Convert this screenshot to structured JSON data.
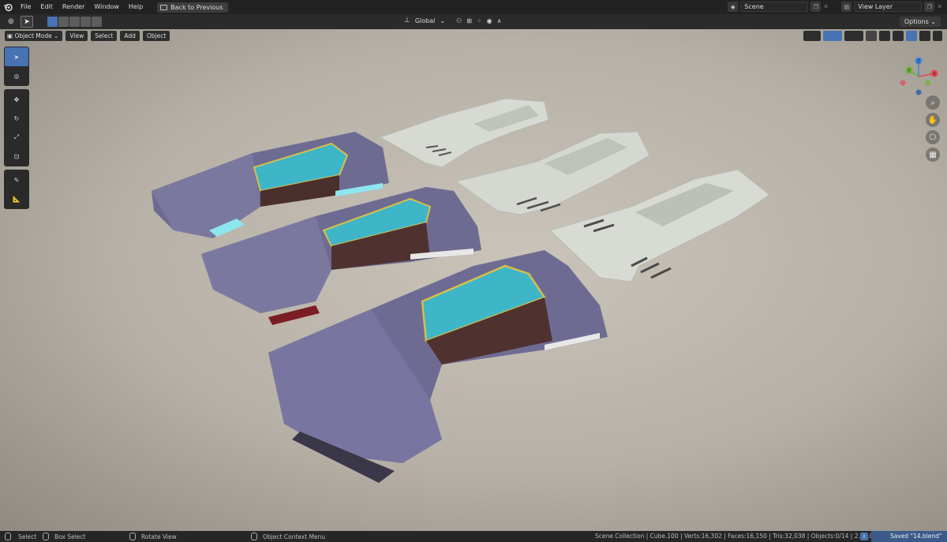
{
  "menubar": {
    "items": [
      "File",
      "Edit",
      "Render",
      "Window",
      "Help"
    ],
    "back_button": "Back to Previous",
    "scene_field": "Scene",
    "view_layer_field": "View Layer"
  },
  "tool_header": {
    "orientation": "Global",
    "options_label": "Options"
  },
  "viewport_header": {
    "mode": "Object Mode",
    "menus": [
      "View",
      "Select",
      "Add",
      "Object"
    ]
  },
  "gizmo": {
    "x_label": "X",
    "y_label": "Y",
    "z_label": "Z"
  },
  "statusbar": {
    "select": "Select",
    "box_select": "Box Select",
    "rotate_view": "Rotate View",
    "object_context_menu": "Object Context Menu",
    "stats": "Scene Collection | Cube.100 | Verts:16,302 | Faces:16,150 | Tris:32,038 | Objects:0/14 | 2.90.0",
    "saved": "Saved \"14.blend\""
  },
  "colors": {
    "accent": "#4772b3",
    "hull": "#6e6b93",
    "glass": "#3fb6c8",
    "trim": "#d4c04a",
    "ghost": "#d9dcd6"
  }
}
